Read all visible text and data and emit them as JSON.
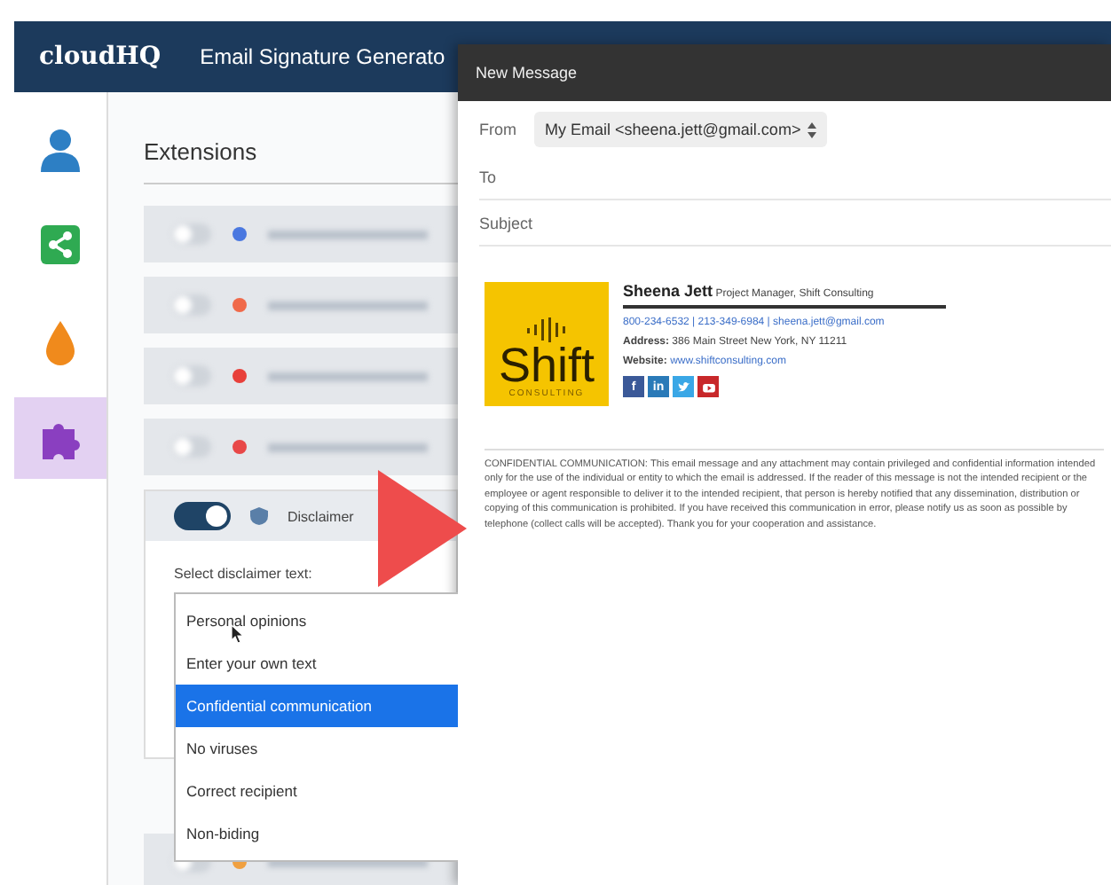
{
  "header": {
    "logo": "cloudHQ",
    "title": "Email Signature Generato"
  },
  "sidebar": {
    "items": [
      {
        "kind": "person",
        "selected": false
      },
      {
        "kind": "share",
        "selected": false
      },
      {
        "kind": "drop",
        "selected": false
      },
      {
        "kind": "puzzle",
        "selected": true
      }
    ]
  },
  "extensions": {
    "title": "Extensions",
    "rows": [
      {
        "color": "#4a78e0"
      },
      {
        "color": "#f06a4a"
      },
      {
        "color": "#e8403a"
      },
      {
        "color": "#e84848"
      }
    ],
    "disclaimer": {
      "on": true,
      "label": "Disclaimer",
      "select_label": "Select disclaimer text:",
      "options": [
        {
          "label": "Personal opinions",
          "selected": false
        },
        {
          "label": "Enter your own text",
          "selected": false
        },
        {
          "label": "Confidential communication",
          "selected": true
        },
        {
          "label": "No viruses",
          "selected": false
        },
        {
          "label": "Correct recipient",
          "selected": false
        },
        {
          "label": "Non-biding",
          "selected": false
        }
      ]
    },
    "rows_after": [
      {
        "color": "#f0a040"
      }
    ]
  },
  "compose": {
    "title": "New Message",
    "from_label": "From",
    "from_value": "My Email <sheena.jett@gmail.com>",
    "to_label": "To",
    "subject_label": "Subject",
    "signature": {
      "logo_word": "Shift",
      "logo_sub": "CONSULTING",
      "name": "Sheena Jett",
      "role": "Project Manager, Shift Consulting",
      "contacts": "800-234-6532 | 213-349-6984 | sheena.jett@gmail.com",
      "address_label": "Address:",
      "address": "386 Main Street New York, NY 11211",
      "website_label": "Website:",
      "website": "www.shiftconsulting.com",
      "social": [
        {
          "kind": "facebook",
          "label": "f",
          "color": "#3b5998"
        },
        {
          "kind": "linkedin",
          "label": "in",
          "color": "#2a7ab8"
        },
        {
          "kind": "twitter",
          "color": "#3aa7e6"
        },
        {
          "kind": "youtube",
          "color": "#c8282a"
        }
      ]
    },
    "disclaimer": "CONFIDENTIAL COMMUNICATION: This email message and any attachment may contain privileged and confidential information intended only for the use of the individual or entity to which the email is addressed. If the reader of this message is not the intended recipient or the employee or agent responsible to deliver it to the intended recipient, that person is hereby notified that any dissemination, distribution or copying of this communication is prohibited. If you have received this communication in error, please notify us as soon as possible by telephone (collect calls will be accepted). Thank you for your cooperation and assistance."
  }
}
